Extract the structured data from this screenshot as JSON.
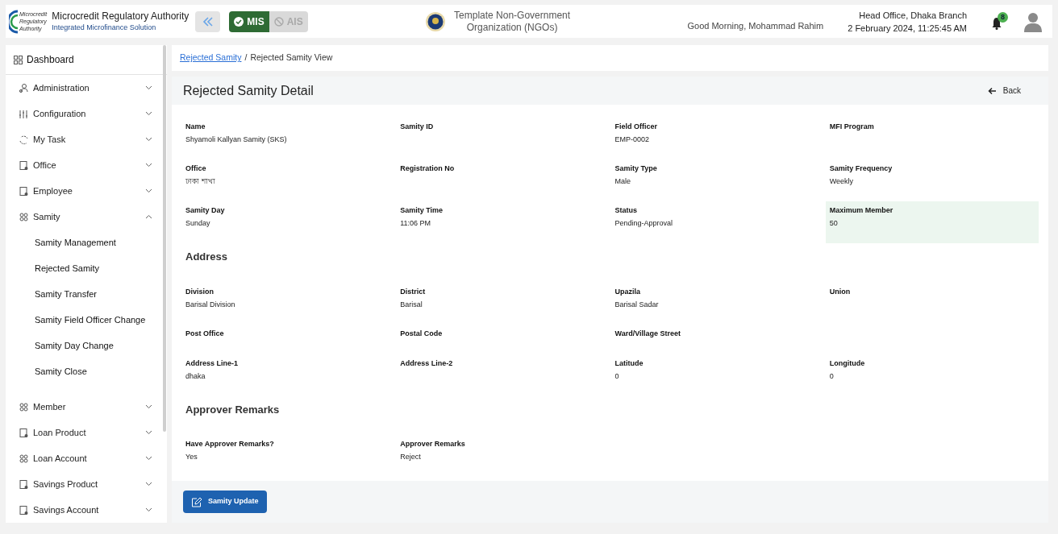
{
  "header": {
    "org_name": "Microcredit Regulatory Authority",
    "org_subtitle": "Integrated Microfinance Solution",
    "logo_text": [
      "Microcredit",
      "Regulatory",
      "Authority"
    ],
    "modules": [
      {
        "label": "MIS",
        "selected": true
      },
      {
        "label": "AIS",
        "selected": false
      }
    ],
    "ngo_name": [
      "Template Non-Government",
      "Organization (NGOs)"
    ],
    "greeting": "Good Morning, Mohammad Rahim",
    "branch": "Head Office, Dhaka Branch",
    "datetime": "2 February 2024, 11:25:45 AM",
    "notification_count": "8"
  },
  "sidebar": {
    "dashboard": "Dashboard",
    "items": [
      {
        "label": "Administration",
        "expanded": false
      },
      {
        "label": "Configuration",
        "expanded": false
      },
      {
        "label": "My Task",
        "expanded": false
      },
      {
        "label": "Office",
        "expanded": false
      },
      {
        "label": "Employee",
        "expanded": false
      },
      {
        "label": "Samity",
        "expanded": true,
        "children": [
          {
            "label": "Samity Management"
          },
          {
            "label": "Rejected Samity"
          },
          {
            "label": "Samity Transfer"
          },
          {
            "label": "Samity Field Officer Change"
          },
          {
            "label": "Samity Day Change"
          },
          {
            "label": "Samity Close"
          }
        ]
      },
      {
        "label": "Member",
        "expanded": false
      },
      {
        "label": "Loan Product",
        "expanded": false
      },
      {
        "label": "Loan Account",
        "expanded": false
      },
      {
        "label": "Savings Product",
        "expanded": false
      },
      {
        "label": "Savings Account",
        "expanded": false
      }
    ]
  },
  "breadcrumb": {
    "link": "Rejected Samity",
    "separator": "/",
    "current": "Rejected Samity View"
  },
  "page_title": "Rejected Samity Detail",
  "back_label": "Back",
  "sections": [
    {
      "rows": [
        [
          {
            "label": "Name",
            "value": "Shyamoli Kallyan Samity (SKS)",
            "highlighted": false
          },
          {
            "label": "Samity ID",
            "highlighted": false
          },
          {
            "label": "Field Officer",
            "value": "EMP-0002",
            "highlighted": false
          },
          {
            "label": "MFI Program",
            "highlighted": false
          }
        ],
        [
          {
            "label": "Office",
            "value": "ঢাকা শাখা",
            "highlighted": false
          },
          {
            "label": "Registration No",
            "highlighted": false
          },
          {
            "label": "Samity Type",
            "value": "Male",
            "highlighted": false
          },
          {
            "label": "Samity Frequency",
            "value": "Weekly",
            "highlighted": false
          }
        ],
        [
          {
            "label": "Samity Day",
            "value": "Sunday",
            "highlighted": false
          },
          {
            "label": "Samity Time",
            "value": "11:06 PM",
            "highlighted": false
          },
          {
            "label": "Status",
            "value": "Pending-Approval",
            "highlighted": false
          },
          {
            "label": "Maximum Member",
            "value": "50",
            "highlighted": true
          }
        ]
      ]
    },
    {
      "title": "Address",
      "rows": [
        [
          {
            "label": "Division",
            "value": "Barisal Division",
            "highlighted": false
          },
          {
            "label": "District",
            "value": "Barisal",
            "highlighted": false
          },
          {
            "label": "Upazila",
            "value": "Barisal Sadar",
            "highlighted": false
          },
          {
            "label": "Union",
            "highlighted": false
          }
        ],
        [
          {
            "label": "Post Office",
            "highlighted": false
          },
          {
            "label": "Postal Code",
            "highlighted": false
          },
          {
            "label": "Ward/Village Street",
            "highlighted": false
          }
        ],
        [
          {
            "label": "Address Line-1",
            "value": "dhaka",
            "highlighted": false
          },
          {
            "label": "Address Line-2",
            "highlighted": false
          },
          {
            "label": "Latitude",
            "value": "0",
            "highlighted": false
          },
          {
            "label": "Longitude",
            "value": "0",
            "highlighted": false
          }
        ]
      ]
    },
    {
      "title": "Approver Remarks",
      "rows": [
        [
          {
            "label": "Have Approver Remarks?",
            "value": "Yes",
            "highlighted": false
          },
          {
            "label": "Approver Remarks",
            "value": "Reject",
            "highlighted": false
          }
        ]
      ]
    }
  ],
  "update_button": "Samity Update"
}
